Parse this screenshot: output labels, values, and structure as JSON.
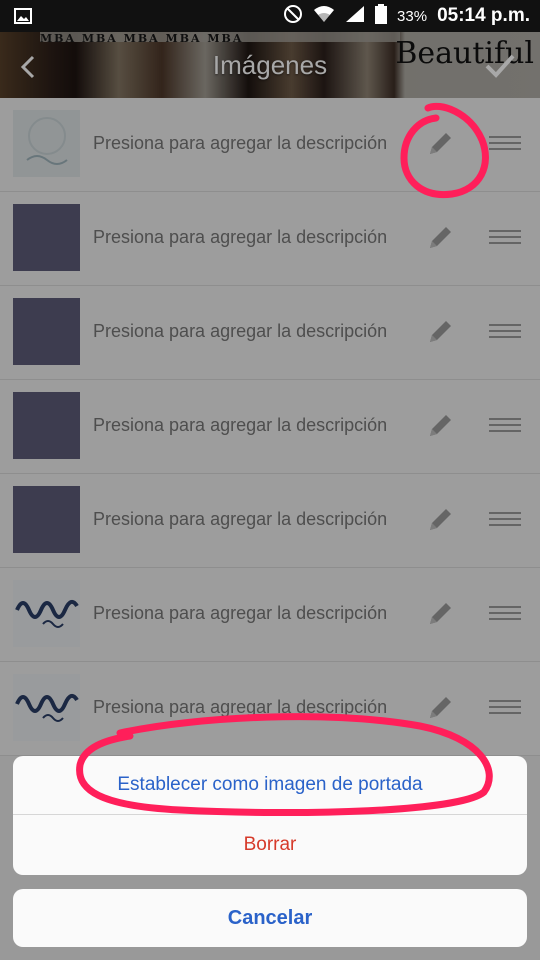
{
  "status_bar": {
    "battery_percent": "33%",
    "time": "05:14 p.m.",
    "icons": [
      "gallery-icon",
      "do-not-disturb-icon",
      "wifi-icon",
      "signal-icon",
      "battery-icon"
    ]
  },
  "header": {
    "title": "Imágenes",
    "banner_masthead": "MBA MBA MBA MBA MBA",
    "banner_text": "Beautiful",
    "back_icon": "chevron-left-icon",
    "confirm_icon": "check-icon"
  },
  "list": {
    "items": [
      {
        "description": "Presiona para agregar la descripción",
        "thumb": "light"
      },
      {
        "description": "Presiona para agregar la descripción",
        "thumb": "solid"
      },
      {
        "description": "Presiona para agregar la descripción",
        "thumb": "solid"
      },
      {
        "description": "Presiona para agregar la descripción",
        "thumb": "solid"
      },
      {
        "description": "Presiona para agregar la descripción",
        "thumb": "solid"
      },
      {
        "description": "Presiona para agregar la descripción",
        "thumb": "script"
      },
      {
        "description": "Presiona para agregar la descripción",
        "thumb": "script"
      }
    ]
  },
  "action_sheet": {
    "set_cover_label": "Establecer como imagen de portada",
    "delete_label": "Borrar",
    "cancel_label": "Cancelar"
  },
  "colors": {
    "accent_blue": "#2a62c9",
    "danger_red": "#d63a2a",
    "annotation_pink": "#ff1f5a",
    "thumb_purple": "#5d5b78"
  }
}
